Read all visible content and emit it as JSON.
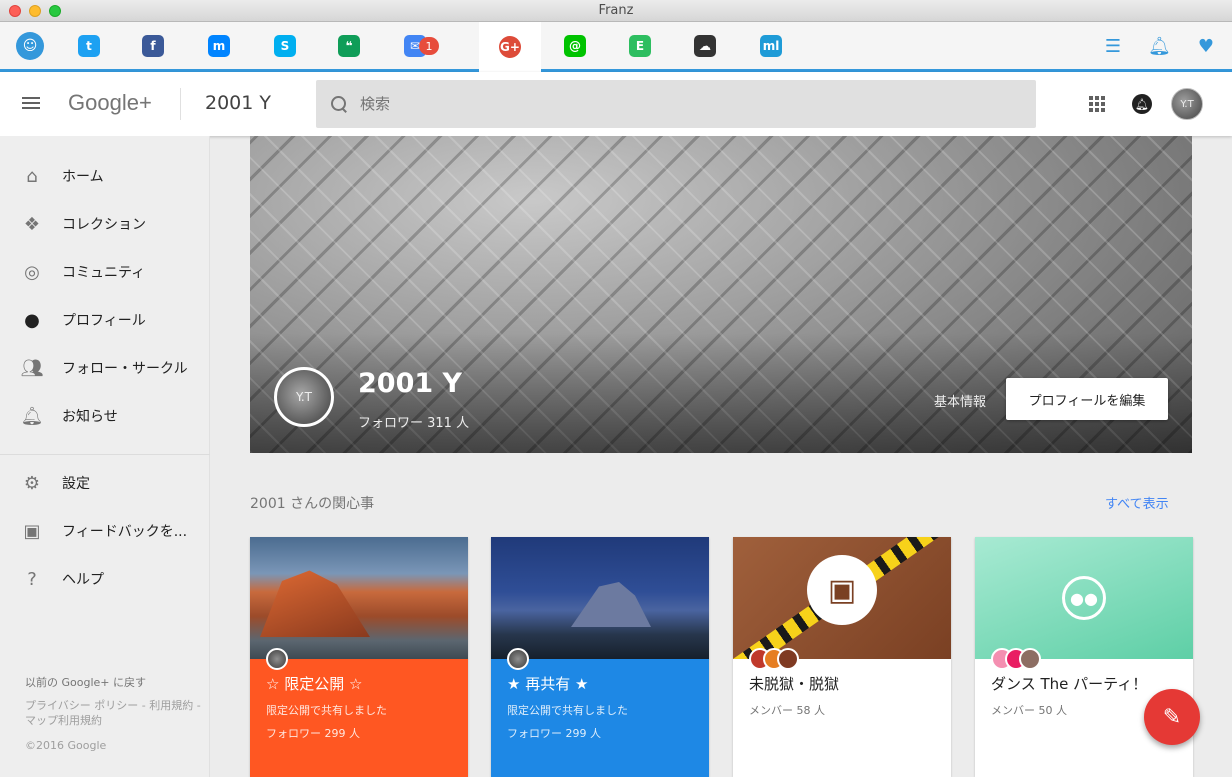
{
  "window": {
    "title": "Franz"
  },
  "tabs": {
    "services": [
      {
        "name": "twitter",
        "icon": "twitter-icon",
        "glyph": "t",
        "color": "#1da1f2"
      },
      {
        "name": "facebook",
        "icon": "facebook-icon",
        "glyph": "f",
        "color": "#3b5998"
      },
      {
        "name": "messenger",
        "icon": "messenger-icon",
        "glyph": "m",
        "color": "#0084ff"
      },
      {
        "name": "skype",
        "icon": "skype-icon",
        "glyph": "S",
        "color": "#00aff0"
      },
      {
        "name": "hangouts",
        "icon": "hangouts-icon",
        "glyph": "❝",
        "color": "#0f9d58"
      },
      {
        "name": "inbox",
        "icon": "inbox-icon",
        "glyph": "✉",
        "color": "#4285f4",
        "badge": "1"
      },
      {
        "name": "googleplus",
        "icon": "googleplus-icon",
        "glyph": "G+",
        "color": "#dd4b39"
      },
      {
        "name": "line",
        "icon": "line-icon",
        "glyph": "@",
        "color": "#00c300"
      },
      {
        "name": "evernote",
        "icon": "evernote-icon",
        "glyph": "E",
        "color": "#2dbe60"
      },
      {
        "name": "icloud",
        "icon": "icloud-icon",
        "glyph": "☁",
        "color": "#333333"
      },
      {
        "name": "mastodon",
        "icon": "ml-icon",
        "glyph": "ml",
        "color": "#1e9bd7"
      }
    ]
  },
  "header": {
    "logo": "Google+",
    "page_name": "2001 Y",
    "search_placeholder": "検索"
  },
  "nav": {
    "items": [
      {
        "label": "ホーム",
        "icon": "home-icon"
      },
      {
        "label": "コレクション",
        "icon": "collections-icon"
      },
      {
        "label": "コミュニティ",
        "icon": "communities-icon"
      },
      {
        "label": "プロフィール",
        "icon": "profile-icon"
      },
      {
        "label": "フォロー・サークル",
        "icon": "people-icon"
      },
      {
        "label": "お知らせ",
        "icon": "bell-icon"
      }
    ],
    "items2": [
      {
        "label": "設定",
        "icon": "gear-icon"
      },
      {
        "label": "フィードバックを...",
        "icon": "feedback-icon"
      },
      {
        "label": "ヘルプ",
        "icon": "help-icon"
      }
    ],
    "back_link": "以前の Google+ に戻す",
    "policy": "プライバシー ポリシー - 利用規約 - マップ利用規約",
    "copyright": "©2016 Google"
  },
  "profile": {
    "name": "2001 Y",
    "followers": "フォロワー 311 人",
    "info_link": "基本情報",
    "edit_button": "プロフィールを編集",
    "avatar_text": "Y.T"
  },
  "interests": {
    "title": "2001 さんの関心事",
    "see_all": "すべて表示",
    "cards": [
      {
        "title": "☆ 限定公開 ☆",
        "sub": "限定公開で共有しました",
        "meta": "フォロワー 299 人"
      },
      {
        "title": "★ 再共有 ★",
        "sub": "限定公開で共有しました",
        "meta": "フォロワー 299 人"
      },
      {
        "title": "未脱獄・脱獄",
        "sub": "メンバー 58 人"
      },
      {
        "title": "ダンス The パーティ！",
        "sub": "メンバー 50 人"
      }
    ]
  }
}
